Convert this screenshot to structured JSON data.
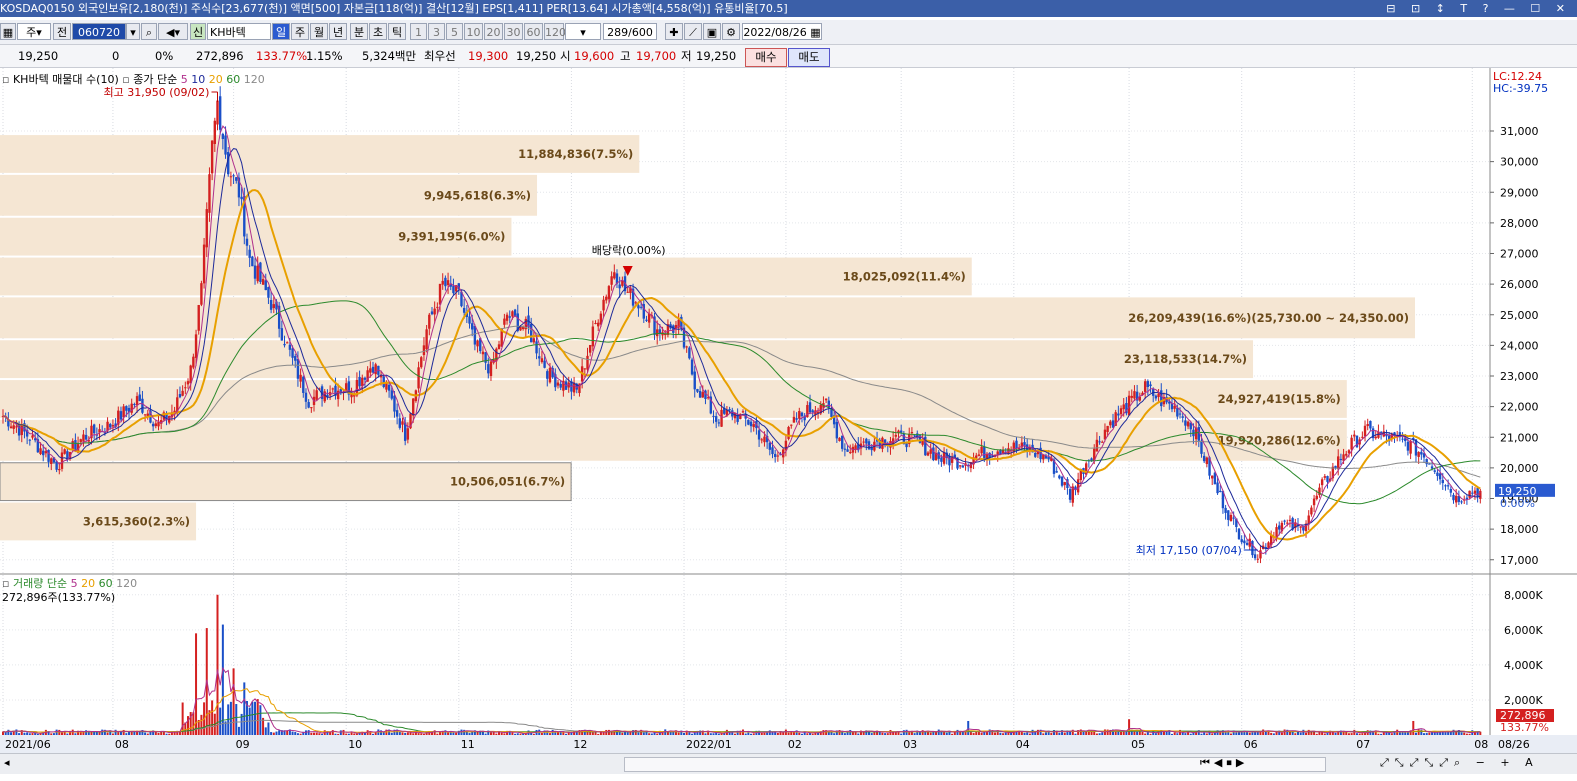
{
  "window": {
    "title": "KOSDAQ0150 외국인보유[2,180(천)] 주식수[23,677(천)] 액면[500] 자본금[118(억)] 결산[12월] EPS[1,411] PER[13.64] 시가총액[4,558(억)] 유통비율[70.5]",
    "controls": "⊟ ⊡ ↕ T ?  — ☐ ✕"
  },
  "toolbar": {
    "period_select": "주",
    "prev_label": "전",
    "code_value": "060720",
    "stock_badge": "신",
    "stock_name": "KH바텍",
    "periods": [
      "일",
      "주",
      "월",
      "년",
      "분",
      "초",
      "틱"
    ],
    "numbers": [
      "1",
      "3",
      "5",
      "10",
      "20",
      "30",
      "60",
      "120"
    ],
    "count": "289",
    "count_total": "/600",
    "date": "2022/08/26"
  },
  "quote": {
    "price": "19,250",
    "change": "0",
    "change_pct": "0%",
    "volume": "272,896",
    "volume_ratio": "133.77%",
    "turnover": "1.15%",
    "amount": "5,324백만",
    "best_label": "최우선",
    "best_ask": "19,300",
    "best_bid": "19,250",
    "open_label": "시",
    "open": "19,600",
    "high_label": "고",
    "high": "19,700",
    "low_label": "저",
    "low": "19,250",
    "buy_label": "매수",
    "sell_label": "매도"
  },
  "price_legend": {
    "name": "KH바텍 매물대 수(10)",
    "ma_label": "종가 단순",
    "periods": [
      "5",
      "10",
      "20",
      "60",
      "120"
    ],
    "colors": [
      "#b0308c",
      "#1e2a9a",
      "#e8a000",
      "#2c8a2c",
      "#8a8a8a"
    ]
  },
  "volume_legend": {
    "name": "거래량 단순",
    "periods": [
      "5",
      "20",
      "60",
      "120"
    ],
    "colors": [
      "#b0308c",
      "#e8a000",
      "#2c8a2c",
      "#8a8a8a"
    ],
    "current": "272,896주(133.77%)"
  },
  "lc_hc": {
    "lc": "LC:12.24",
    "hc": "HC:-39.75"
  },
  "annotations": {
    "high": "최고 31,950 (09/02)",
    "low": "최저 17,150 (07/04)",
    "dividend": "배당락(0.00%)"
  },
  "price_marker": {
    "value": "19,250",
    "pct": "0.00%"
  },
  "volume_marker": {
    "value": "272,896",
    "pct": "133.77%"
  },
  "last_date_label": "08/26",
  "colors": {
    "up": "#d42020",
    "down": "#1a4fc8",
    "volume_profile": "#f5e6d3",
    "profile_text": "#6b4a1a"
  },
  "chart_data": {
    "type": "candlestick",
    "y_axis": {
      "min": 16600,
      "max": 32600,
      "ticks": [
        "17,000",
        "18,000",
        "19,000",
        "20,000",
        "21,000",
        "22,000",
        "23,000",
        "24,000",
        "25,000",
        "26,000",
        "27,000",
        "28,000",
        "29,000",
        "30,000",
        "31,000"
      ]
    },
    "x_labels": [
      "2021/06",
      "08",
      "09",
      "10",
      "11",
      "12",
      "2022/01",
      "02",
      "03",
      "04",
      "05",
      "06",
      "07",
      "08"
    ],
    "volume_profile": [
      {
        "low": 17600,
        "high": 18900,
        "label": "3,615,360(2.3%)",
        "share": 2.3
      },
      {
        "low": 18900,
        "high": 20200,
        "label": "10,506,051(6.7%)",
        "share": 6.7
      },
      {
        "low": 20200,
        "high": 21600,
        "label": "24,927,419(15.8%)",
        "share": 15.8
      },
      {
        "low": 21600,
        "high": 22900,
        "label": "24,927,419(15.8%)",
        "share": 15.8
      },
      {
        "low": 22900,
        "high": 24200,
        "label": "23,118,533(14.7%)",
        "share": 14.7
      },
      {
        "low": 24200,
        "high": 25600,
        "label": "26,209,439(16.6%)(25,730.00 ~ 24,350.00)",
        "share": 16.6
      },
      {
        "low": 25600,
        "high": 26900,
        "label": "18,025,092(11.4%)",
        "share": 11.4
      },
      {
        "low": 26900,
        "high": 28200,
        "label": "9,391,195(6.0%)",
        "share": 6.0
      },
      {
        "low": 28200,
        "high": 29600,
        "label": "9,945,618(6.3%)",
        "share": 6.3
      },
      {
        "low": 29600,
        "high": 30900,
        "label": "11,884,836(7.5%)",
        "share": 7.5
      }
    ],
    "volume_profile_labels": [
      {
        "label": "3,615,360(2.3%)",
        "low": 17600,
        "high": 18900
      },
      {
        "label": "10,506,051(6.7%)",
        "low": 18900,
        "high": 20200
      },
      {
        "label": "19,920,286(12.6%)",
        "low": 20200,
        "high": 21600
      },
      {
        "label": "24,927,419(15.8%)",
        "low": 21600,
        "high": 22900
      },
      {
        "label": "23,118,533(14.7%)",
        "low": 22900,
        "high": 24200
      },
      {
        "label": "26,209,439(16.6%)(25,730.00 ~ 24,350.00)",
        "low": 24200,
        "high": 25600
      },
      {
        "label": "18,025,092(11.4%)",
        "low": 25600,
        "high": 26900
      },
      {
        "label": "9,391,195(6.0%)",
        "low": 26900,
        "high": 28200
      },
      {
        "label": "9,945,618(6.3%)",
        "low": 28200,
        "high": 29600
      },
      {
        "label": "11,884,836(7.5%)",
        "low": 29600,
        "high": 30900
      }
    ],
    "price_keypoints": [
      [
        0,
        21700
      ],
      [
        10,
        21000
      ],
      [
        20,
        20100
      ],
      [
        30,
        21000
      ],
      [
        40,
        21400
      ],
      [
        50,
        22200
      ],
      [
        58,
        21400
      ],
      [
        64,
        21900
      ],
      [
        70,
        23200
      ],
      [
        74,
        25800
      ],
      [
        78,
        30500
      ],
      [
        80,
        31950
      ],
      [
        84,
        29800
      ],
      [
        88,
        29000
      ],
      [
        92,
        26800
      ],
      [
        100,
        25400
      ],
      [
        108,
        23500
      ],
      [
        114,
        22200
      ],
      [
        122,
        22600
      ],
      [
        130,
        22600
      ],
      [
        138,
        23400
      ],
      [
        144,
        22400
      ],
      [
        150,
        21100
      ],
      [
        158,
        24500
      ],
      [
        164,
        26000
      ],
      [
        170,
        25600
      ],
      [
        176,
        24000
      ],
      [
        182,
        23200
      ],
      [
        188,
        25000
      ],
      [
        196,
        24500
      ],
      [
        204,
        23000
      ],
      [
        214,
        22500
      ],
      [
        222,
        25000
      ],
      [
        228,
        26500
      ],
      [
        232,
        25800
      ],
      [
        238,
        25300
      ],
      [
        244,
        24500
      ],
      [
        252,
        24600
      ],
      [
        258,
        22800
      ],
      [
        266,
        21600
      ],
      [
        272,
        21800
      ],
      [
        280,
        21400
      ],
      [
        288,
        20300
      ],
      [
        296,
        21600
      ],
      [
        306,
        22200
      ],
      [
        314,
        20600
      ],
      [
        322,
        20800
      ],
      [
        332,
        21000
      ],
      [
        340,
        20900
      ],
      [
        350,
        20300
      ],
      [
        358,
        20200
      ],
      [
        366,
        20500
      ],
      [
        374,
        20700
      ],
      [
        382,
        20600
      ],
      [
        390,
        20300
      ],
      [
        398,
        19100
      ],
      [
        404,
        20200
      ],
      [
        412,
        21400
      ],
      [
        420,
        22100
      ],
      [
        426,
        22600
      ],
      [
        432,
        22200
      ],
      [
        438,
        21900
      ],
      [
        444,
        21300
      ],
      [
        452,
        19400
      ],
      [
        460,
        18000
      ],
      [
        468,
        17150
      ],
      [
        476,
        18200
      ],
      [
        484,
        18000
      ],
      [
        492,
        19400
      ],
      [
        500,
        20500
      ],
      [
        508,
        21200
      ],
      [
        516,
        21000
      ],
      [
        524,
        20800
      ],
      [
        530,
        20400
      ],
      [
        536,
        19800
      ],
      [
        542,
        19000
      ],
      [
        548,
        19250
      ]
    ],
    "volume_peaks_k": [
      {
        "i": 72,
        "v": 5800
      },
      {
        "i": 76,
        "v": 6100
      },
      {
        "i": 80,
        "v": 8000
      },
      {
        "i": 82,
        "v": 6300
      },
      {
        "i": 86,
        "v": 3800
      },
      {
        "i": 90,
        "v": 3000
      },
      {
        "i": 96,
        "v": 1700
      },
      {
        "i": 420,
        "v": 900
      },
      {
        "i": 360,
        "v": 800
      },
      {
        "i": 526,
        "v": 800
      },
      {
        "i": 548,
        "v": 273
      }
    ],
    "volume_ticks": [
      "2,000K",
      "4,000K",
      "6,000K",
      "8,000K"
    ],
    "volume_ylim": [
      0,
      8500
    ]
  }
}
